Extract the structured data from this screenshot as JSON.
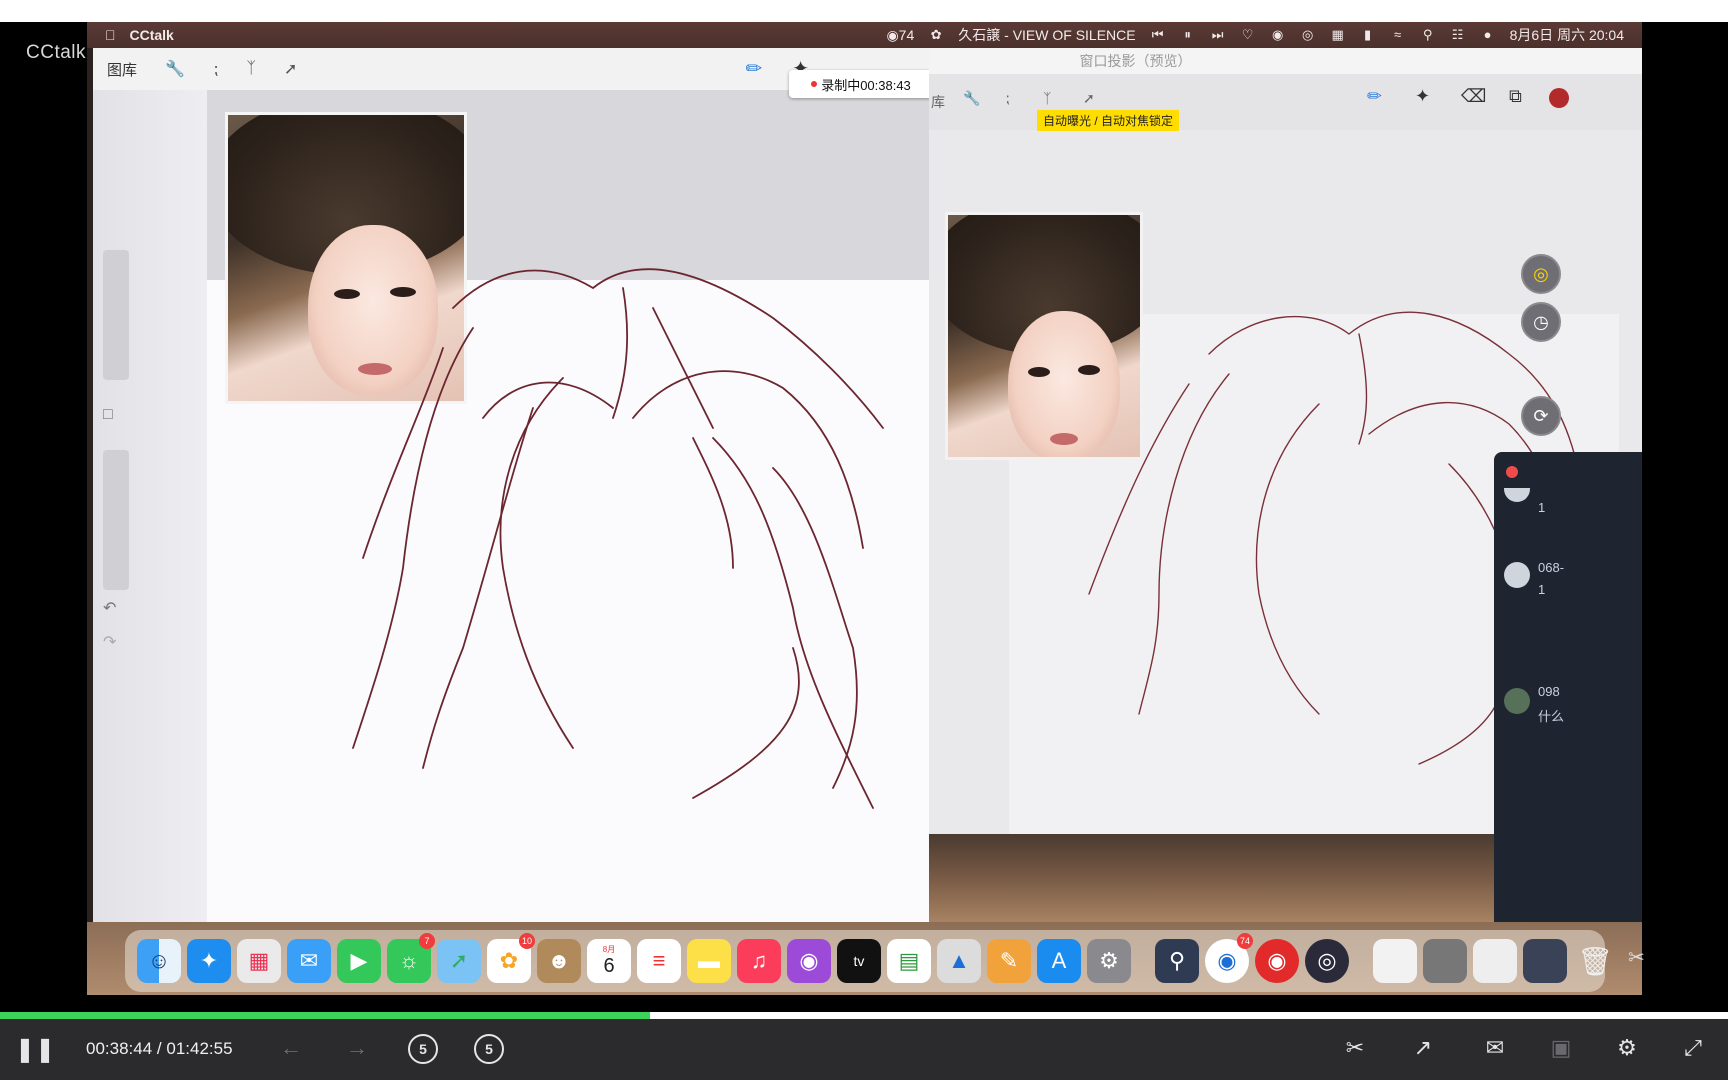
{
  "app": {
    "brand": "CCtalk"
  },
  "menubar": {
    "app_name": "CCtalk",
    "notif_count": "74",
    "now_playing": "久石譲 - VIEW OF SILENCE",
    "datetime": "8月6日 周六 20:04"
  },
  "procreate": {
    "gallery_label": "图库",
    "recording_badge": "录制中00:38:43"
  },
  "projection": {
    "title": "窗口投影（预览）",
    "ipad_gallery_label": "库",
    "auto_exposure_label": "自动曝光 / 自动对焦锁定"
  },
  "chat": {
    "items": [
      {
        "name": "",
        "text": "1"
      },
      {
        "name": "068-",
        "text": "1"
      },
      {
        "name": "098",
        "text": "什么"
      }
    ]
  },
  "dock": {
    "badges": {
      "messages": "7",
      "photos": "10",
      "calendar_day": "6",
      "calendar_month": "8月",
      "cctalk": "74"
    },
    "icons": [
      "finder-icon",
      "safari-icon",
      "launchpad-icon",
      "mail-icon",
      "facetime-icon",
      "messages-icon",
      "maps-icon",
      "photos-icon",
      "contacts-icon",
      "calendar-icon",
      "reminders-icon",
      "notes-icon",
      "music-icon",
      "podcasts-icon",
      "appletv-icon",
      "numbers-icon",
      "keynote-icon",
      "pages-icon",
      "appstore-icon",
      "settings-icon",
      "quicktime-icon",
      "cctalk-icon",
      "netease-icon",
      "obs-icon",
      "trash-icon"
    ]
  },
  "player": {
    "current_time": "00:38:44",
    "separator": "/",
    "total_time": "01:42:55",
    "progress_fraction": 0.376,
    "skip_back_label": "5",
    "skip_forward_label": "5",
    "accent": "#3cd35a"
  }
}
